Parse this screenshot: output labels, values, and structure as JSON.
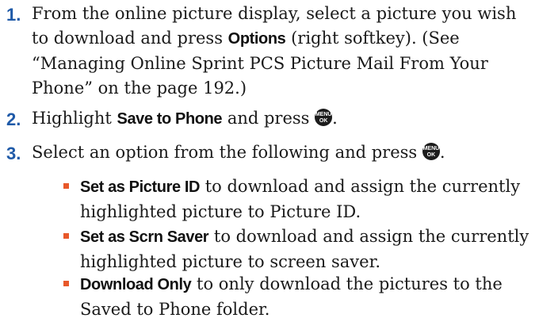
{
  "steps": [
    {
      "number": "1.",
      "text_a": "From the online picture display, select a picture you wish to download and press ",
      "bold": "Options",
      "text_b": " (right softkey). (See “Managing Online Sprint PCS Picture Mail From Your Phone” on the page 192.)"
    },
    {
      "number": "2.",
      "text_a": "Highlight ",
      "bold": "Save to Phone",
      "text_b": " and press ",
      "text_c": "."
    },
    {
      "number": "3.",
      "text_a": "Select an option from the following and press ",
      "text_c": "."
    }
  ],
  "menu_key": {
    "top": "MENU",
    "bottom": "OK",
    "icon": "menu-ok-key-icon"
  },
  "options": [
    {
      "bold": "Set as Picture ID",
      "text": " to download and assign the currently highlighted picture to Picture ID."
    },
    {
      "bold": "Set as Scrn Saver",
      "text": " to download and assign the currently highlighted picture to screen saver."
    },
    {
      "bold": "Download Only",
      "text": " to only download the pictures to the Saved to Phone folder."
    }
  ],
  "colors": {
    "step_number": "#1f5aa8",
    "bullet": "#e8582a"
  }
}
